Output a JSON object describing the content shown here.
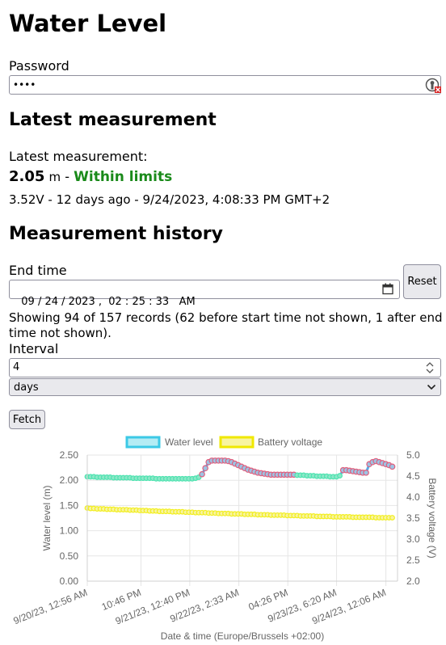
{
  "page": {
    "title": "Water Level",
    "password_label": "Password",
    "password_value": "••••",
    "latest_heading": "Latest measurement",
    "latest_label": "Latest measurement:",
    "latest_value": "2.05",
    "latest_unit": "m",
    "latest_sep": "-",
    "latest_status": "Within limits",
    "latest_details": "3.52V - 12 days ago - 9/24/2023, 4:08:33 PM GMT+2",
    "history_heading": "Measurement history",
    "end_time_label": "End time",
    "end_time_value": "09 / 24 / 2023 ,  02 : 25 : 33   AM",
    "reset_label": "Reset",
    "records_info": "Showing 94 of 157 records (62 before start time not shown, 1 after end time not shown).",
    "interval_label": "Interval",
    "interval_value": "4",
    "unit_selected": "days",
    "fetch_label": "Fetch"
  },
  "chart_data": {
    "type": "line",
    "legend": [
      "Water level",
      "Battery voltage"
    ],
    "legend_position": "top",
    "xlabel": "Date & time (Europe/Brussels +02:00)",
    "ylabel_left": "Water level (m)",
    "ylabel_right": "Battery voltage (V)",
    "ylim_left": [
      0,
      2.5
    ],
    "ylim_right": [
      2.0,
      5.0
    ],
    "yticks_left": [
      "0.00",
      "0.50",
      "1.00",
      "1.50",
      "2.00",
      "2.50"
    ],
    "yticks_right": [
      "2.0",
      "2.5",
      "3.0",
      "3.5",
      "4.0",
      "4.5",
      "5.0"
    ],
    "x_tick_labels": [
      "9/20/23, 12:56 AM",
      "10:46 PM",
      "9/21/23, 12:40 PM",
      "9/22/23, 2:33 AM",
      "04:26 PM",
      "9/23/23, 6:20 AM",
      "9/24/23, 12:06 AM"
    ],
    "colors": {
      "water_line": "#4ee3b0",
      "water_point_in_limits": "#8ce8c8",
      "water_point_high": "#9cc4e4",
      "water_point_high_border": "#e0607e",
      "battery": "#f2ee1e",
      "legend_water_fill": "#b4ecf4",
      "legend_water_border": "#3cc9e6",
      "legend_battery_fill": "#f8f4a0",
      "legend_battery_border": "#f0e800"
    },
    "series": [
      {
        "name": "Water level",
        "x": [
          0,
          2.96,
          5.92,
          8.88,
          11.84,
          14.8,
          17.76,
          20.72,
          23.68,
          26.64,
          29.6,
          32.56,
          35.52,
          38.48,
          41.44,
          44.4,
          47.36,
          50.32,
          53.28,
          56.24,
          59.2,
          62.16,
          65.12,
          68.08,
          71.04,
          74,
          76.96,
          79.92,
          82.88,
          85.84,
          88.8,
          91.76,
          94.72,
          97.68,
          100.64,
          103.6,
          106.56,
          109.52,
          112.48,
          115.44,
          118.4,
          121.36,
          124.32,
          127.28,
          130.24,
          133.2,
          136.16,
          139.12,
          142.08,
          145.04,
          148,
          150.96,
          153.92,
          156.88,
          159.84,
          162.8,
          165.76,
          168.72,
          171.68,
          174.64,
          177.6,
          180.56,
          183.52,
          186.48,
          189.44,
          192.4,
          195.36,
          198.32,
          201.28,
          204.24,
          207.2,
          210.16,
          213.12,
          216.08,
          219.04,
          222,
          224.96,
          227.92,
          230.88,
          233.84,
          236.8,
          239.76,
          242.72,
          245.68,
          248.64,
          251.6,
          254.56,
          257.52,
          260.48,
          263.44,
          266.4,
          269.36,
          272.32,
          275.28
        ],
        "values": [
          2.07,
          2.07,
          2.07,
          2.06,
          2.06,
          2.06,
          2.06,
          2.06,
          2.05,
          2.05,
          2.05,
          2.05,
          2.05,
          2.05,
          2.04,
          2.04,
          2.04,
          2.04,
          2.04,
          2.04,
          2.04,
          2.03,
          2.03,
          2.03,
          2.03,
          2.03,
          2.03,
          2.03,
          2.03,
          2.03,
          2.03,
          2.03,
          2.03,
          2.04,
          2.06,
          2.12,
          2.24,
          2.36,
          2.39,
          2.39,
          2.39,
          2.39,
          2.39,
          2.38,
          2.36,
          2.33,
          2.3,
          2.27,
          2.24,
          2.21,
          2.19,
          2.17,
          2.15,
          2.14,
          2.13,
          2.12,
          2.11,
          2.11,
          2.11,
          2.11,
          2.11,
          2.11,
          2.11,
          2.11,
          2.1,
          2.1,
          2.1,
          2.09,
          2.09,
          2.09,
          2.08,
          2.08,
          2.08,
          2.08,
          2.07,
          2.07,
          2.07,
          2.09,
          2.2,
          2.2,
          2.19,
          2.18,
          2.17,
          2.16,
          2.15,
          2.15,
          2.32,
          2.36,
          2.38,
          2.36,
          2.34,
          2.32,
          2.3,
          2.27
        ]
      },
      {
        "name": "Battery voltage",
        "x": [
          0,
          2.96,
          5.92,
          8.88,
          11.84,
          14.8,
          17.76,
          20.72,
          23.68,
          26.64,
          29.6,
          32.56,
          35.52,
          38.48,
          41.44,
          44.4,
          47.36,
          50.32,
          53.28,
          56.24,
          59.2,
          62.16,
          65.12,
          68.08,
          71.04,
          74,
          76.96,
          79.92,
          82.88,
          85.84,
          88.8,
          91.76,
          94.72,
          97.68,
          100.64,
          103.6,
          106.56,
          109.52,
          112.48,
          115.44,
          118.4,
          121.36,
          124.32,
          127.28,
          130.24,
          133.2,
          136.16,
          139.12,
          142.08,
          145.04,
          148,
          150.96,
          153.92,
          156.88,
          159.84,
          162.8,
          165.76,
          168.72,
          171.68,
          174.64,
          177.6,
          180.56,
          183.52,
          186.48,
          189.44,
          192.4,
          195.36,
          198.32,
          201.28,
          204.24,
          207.2,
          210.16,
          213.12,
          216.08,
          219.04,
          222,
          224.96,
          227.92,
          230.88,
          233.84,
          236.8,
          239.76,
          242.72,
          245.68,
          248.64,
          251.6,
          254.56,
          257.52,
          260.48,
          263.44,
          266.4,
          269.36,
          272.32,
          275.28
        ],
        "values": [
          3.74,
          3.73,
          3.73,
          3.72,
          3.72,
          3.72,
          3.71,
          3.71,
          3.71,
          3.7,
          3.7,
          3.7,
          3.7,
          3.69,
          3.69,
          3.69,
          3.68,
          3.68,
          3.68,
          3.67,
          3.67,
          3.67,
          3.66,
          3.66,
          3.66,
          3.66,
          3.65,
          3.65,
          3.65,
          3.65,
          3.64,
          3.64,
          3.64,
          3.63,
          3.63,
          3.63,
          3.63,
          3.62,
          3.62,
          3.62,
          3.61,
          3.61,
          3.61,
          3.61,
          3.6,
          3.6,
          3.6,
          3.6,
          3.59,
          3.59,
          3.59,
          3.59,
          3.58,
          3.58,
          3.58,
          3.58,
          3.57,
          3.57,
          3.57,
          3.57,
          3.57,
          3.56,
          3.56,
          3.56,
          3.56,
          3.55,
          3.55,
          3.55,
          3.55,
          3.55,
          3.54,
          3.54,
          3.54,
          3.54,
          3.54,
          3.53,
          3.53,
          3.53,
          3.53,
          3.53,
          3.53,
          3.52,
          3.52,
          3.52,
          3.52,
          3.52,
          3.52,
          3.52,
          3.51,
          3.51,
          3.51,
          3.51,
          3.51,
          3.51
        ]
      }
    ]
  }
}
